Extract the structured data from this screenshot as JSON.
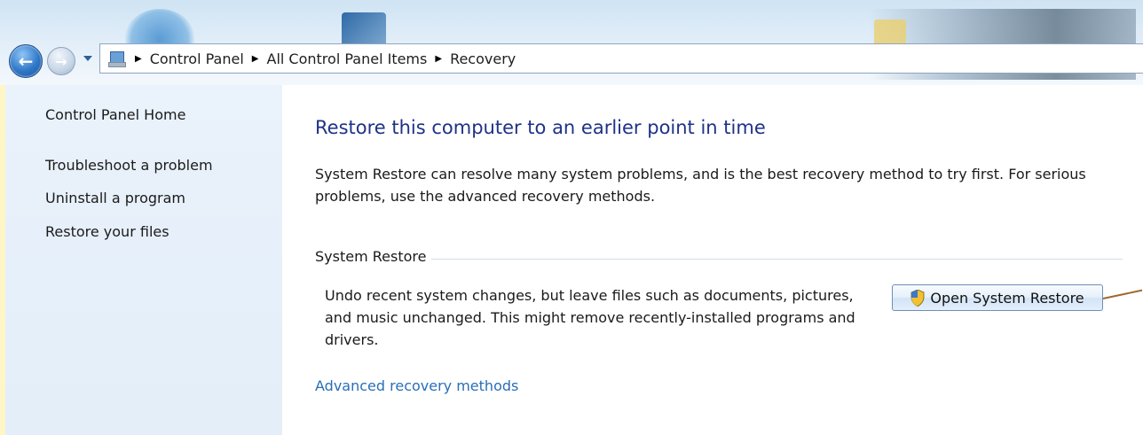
{
  "breadcrumb": {
    "items": [
      "Control Panel",
      "All Control Panel Items",
      "Recovery"
    ]
  },
  "nav_pane": {
    "home_label": "Control Panel Home",
    "links": [
      "Troubleshoot a problem",
      "Uninstall a program",
      "Restore your files"
    ]
  },
  "main": {
    "heading": "Restore this computer to an earlier point in time",
    "description": "System Restore can resolve many system problems, and is the best recovery method to try first. For serious problems, use the advanced recovery methods.",
    "system_restore": {
      "title": "System Restore",
      "description": "Undo recent system changes, but leave files such as documents, pictures, and music unchanged. This might remove recently-installed programs and drivers.",
      "button_label": "Open System Restore"
    },
    "advanced_link": "Advanced recovery methods"
  },
  "icons": {
    "back": "back-arrow-icon",
    "forward": "forward-arrow-icon",
    "recent_pages": "chevron-down-icon",
    "location": "control-panel-icon",
    "shield": "uac-shield-icon"
  },
  "colors": {
    "heading": "#1e3287",
    "link": "#2a6eb8",
    "nav_pane_bg": "#e3eef9",
    "button_border": "#6f8fb3"
  }
}
